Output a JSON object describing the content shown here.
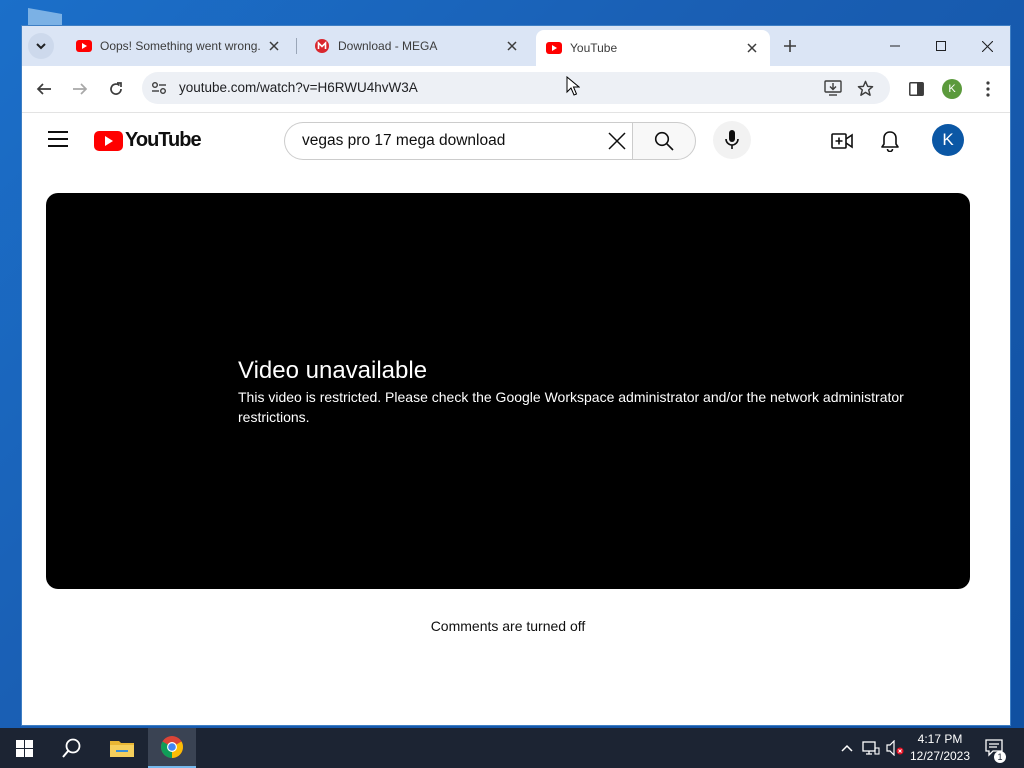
{
  "tabs": [
    {
      "title": "Oops! Something went wrong.",
      "favicon": "youtube-favicon"
    },
    {
      "title": "Download - MEGA",
      "favicon": "mega-favicon"
    },
    {
      "title": "YouTube",
      "favicon": "youtube-favicon"
    }
  ],
  "toolbar": {
    "url": "youtube.com/watch?v=H6RWU4hvW3A",
    "profile_initial": "K"
  },
  "youtube": {
    "logo_text": "YouTube",
    "search_value": "vegas pro 17 mega download",
    "avatar_initial": "K",
    "error_title": "Video unavailable",
    "error_description": "This video is restricted. Please check the Google Workspace administrator and/or the network administrator restrictions.",
    "comments_status": "Comments are turned off"
  },
  "taskbar": {
    "time": "4:17 PM",
    "date": "12/27/2023",
    "notification_count": "1"
  },
  "colors": {
    "youtube_red": "#ff0000",
    "mega_red": "#d9272e",
    "tabstrip_bg": "#dbe5f5",
    "avatar_blue": "#0b57a5",
    "profile_green": "#5b9a3c",
    "taskbar_bg": "#1c2433"
  }
}
